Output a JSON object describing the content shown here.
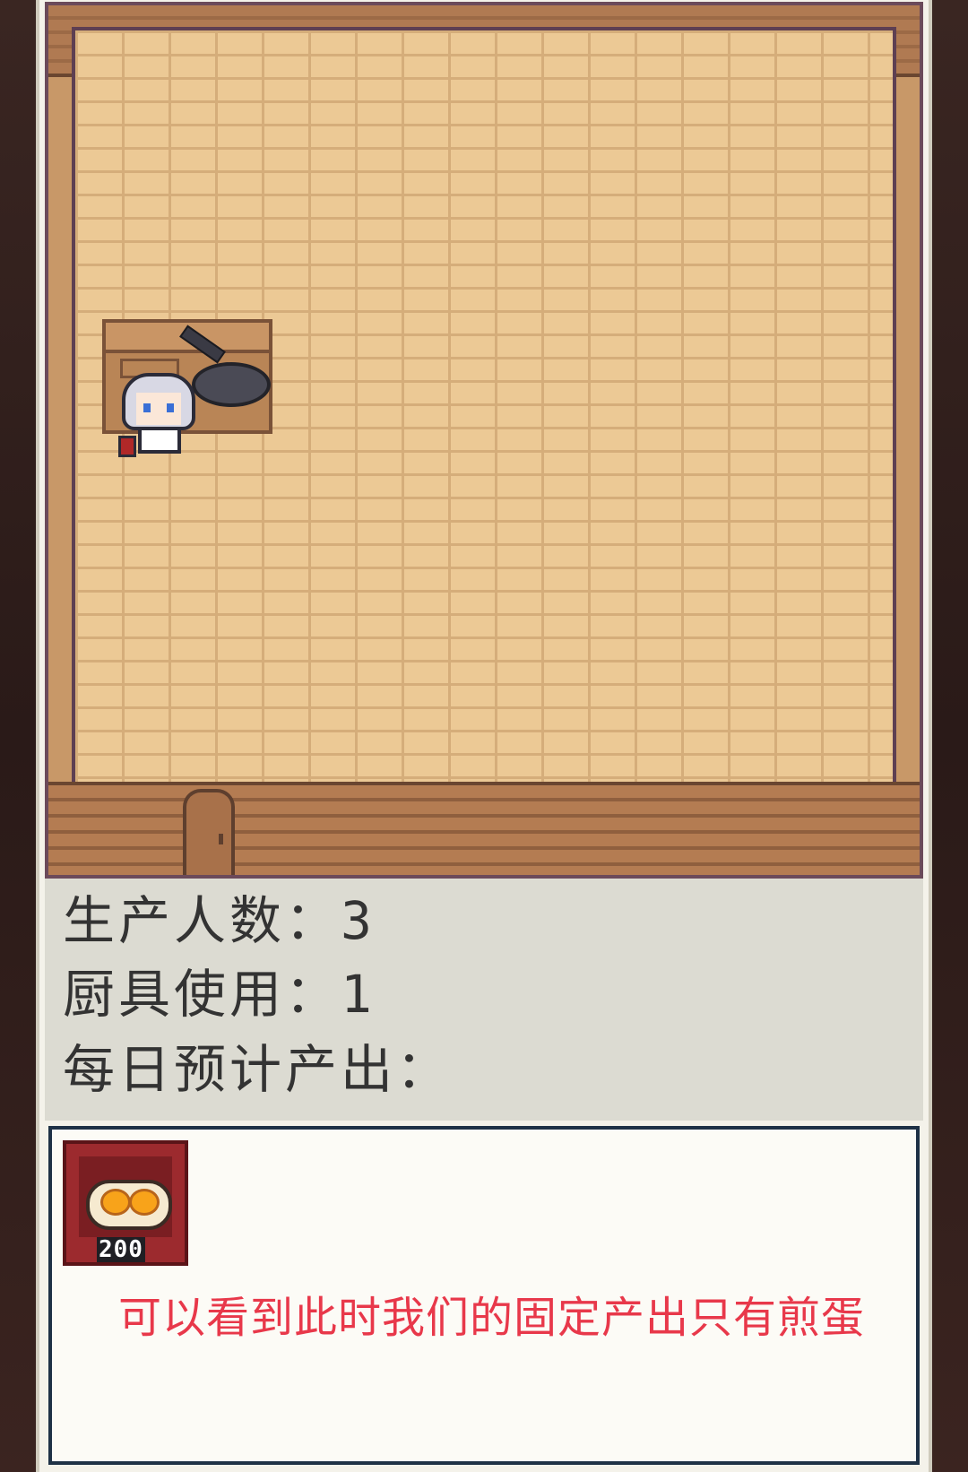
{
  "stats": {
    "workers_line": "生产人数：3",
    "cookware_line": "厨具使用：1",
    "daily_output_line": "每日预计产出："
  },
  "output": {
    "item_name": "fried-egg",
    "item_quantity": "200"
  },
  "caption": "可以看到此时我们的固定产出只有煎蛋",
  "colors": {
    "caption": "#e8384a",
    "item_background": "#9c2a2e",
    "floor": "#ecc995"
  }
}
